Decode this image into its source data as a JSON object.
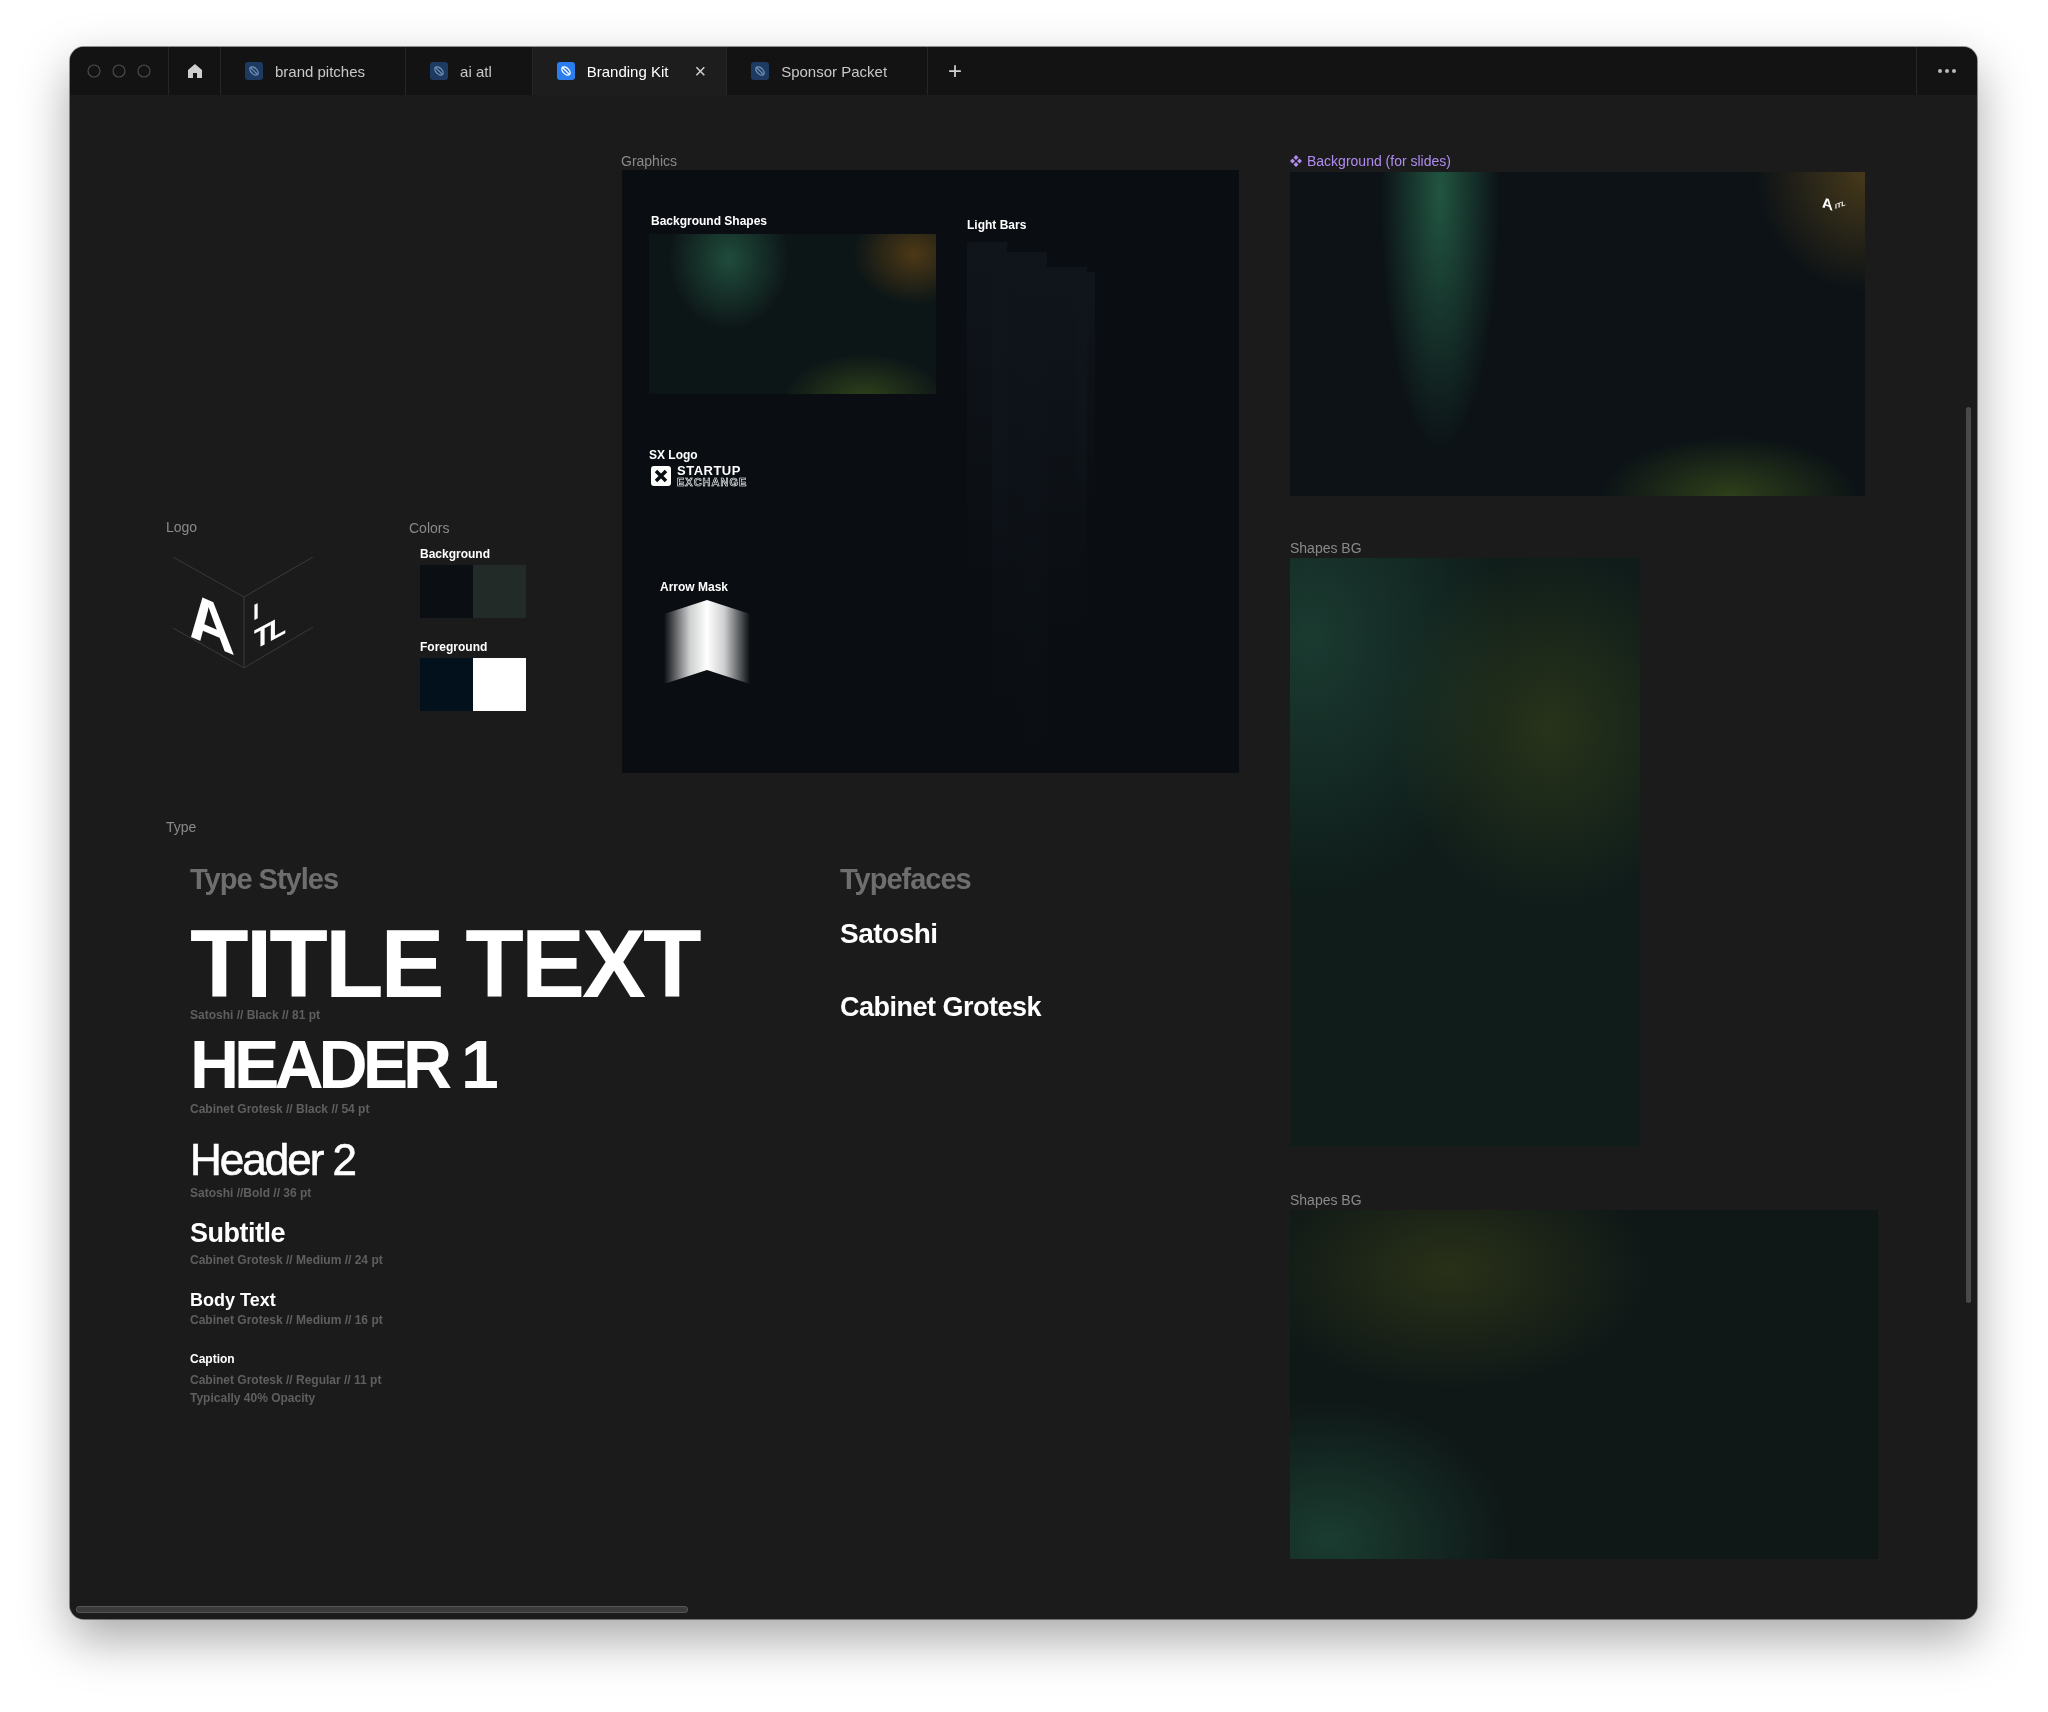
{
  "tabs": [
    {
      "label": "brand pitches",
      "selected": false
    },
    {
      "label": "ai atl",
      "selected": false
    },
    {
      "label": "Branding Kit",
      "selected": true
    },
    {
      "label": "Sponsor Packet",
      "selected": false
    }
  ],
  "close_tab": "×",
  "new_tab": "+",
  "canvas": {
    "logo": {
      "label": "Logo",
      "letters": [
        "A",
        "I",
        "TL"
      ]
    },
    "colors": {
      "label": "Colors",
      "groups": [
        {
          "name": "Background",
          "swatches": [
            {
              "color": "#0b0e12"
            },
            {
              "color": "#222b28"
            }
          ]
        },
        {
          "name": "Foreground",
          "swatches": [
            {
              "color": "#02111b"
            },
            {
              "color": "#ffffff"
            }
          ]
        }
      ]
    },
    "graphics": {
      "label": "Graphics",
      "items": [
        {
          "kind": "shapes",
          "label": "Background Shapes"
        },
        {
          "kind": "bars",
          "label": "Light Bars"
        },
        {
          "kind": "wordmark",
          "label": "SX Logo",
          "lines": [
            "STARTUP",
            "EXCHANGE"
          ]
        },
        {
          "kind": "arrow",
          "label": "Arrow Mask"
        }
      ]
    },
    "type": {
      "label": "Type",
      "styles_heading": "Type Styles",
      "styles": [
        {
          "kind": "title",
          "sample": "TITLE TEXT",
          "spec": [
            "Satoshi // Black //  81 pt"
          ]
        },
        {
          "kind": "h1",
          "sample": "HEADER 1",
          "spec": [
            "Cabinet Grotesk // Black //  54 pt"
          ]
        },
        {
          "kind": "h2",
          "sample": "Header 2",
          "spec": [
            "Satoshi //Bold //  36 pt"
          ]
        },
        {
          "kind": "subtitle",
          "sample": "Subtitle",
          "spec": [
            "Cabinet Grotesk // Medium //  24 pt"
          ]
        },
        {
          "kind": "body",
          "sample": "Body Text",
          "spec": [
            "Cabinet Grotesk // Medium //  16 pt"
          ]
        },
        {
          "kind": "caption",
          "sample": "Caption",
          "spec": [
            "Cabinet Grotesk // Regular //  11 pt",
            "Typically 40% Opacity"
          ]
        }
      ],
      "typefaces_heading": "Typefaces",
      "typefaces": [
        "Satoshi",
        "Cabinet Grotesk"
      ]
    },
    "frames": [
      {
        "label": "Background (for slides)",
        "component": true,
        "mark_letters": [
          "A",
          "ITL"
        ]
      },
      {
        "label": "Shapes BG",
        "component": false
      },
      {
        "label": "Shapes BG",
        "component": false
      }
    ]
  }
}
